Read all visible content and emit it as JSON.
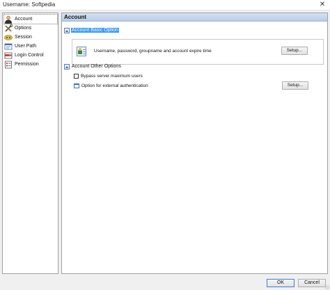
{
  "window": {
    "title": "Username: Softpedia",
    "close_glyph": "✕"
  },
  "sidebar": {
    "items": [
      {
        "label": "Account",
        "icon": "account-user-icon",
        "selected": true
      },
      {
        "label": "Options",
        "icon": "tools-icon",
        "selected": false
      },
      {
        "label": "Session",
        "icon": "session-icon",
        "selected": false
      },
      {
        "label": "User Path",
        "icon": "user-path-icon",
        "selected": false
      },
      {
        "label": "Login Control",
        "icon": "login-control-icon",
        "selected": false
      },
      {
        "label": "Permission",
        "icon": "permission-icon",
        "selected": false
      }
    ]
  },
  "main": {
    "header": "Account",
    "basic_section": {
      "title": "Account Basic Option",
      "description": "Username, password, groupname and account expire time",
      "setup_label": "Setup..."
    },
    "other_section": {
      "title": "Account Other Options",
      "options": [
        {
          "label": "Bypass server maximum users",
          "type": "checkbox",
          "checked": false
        },
        {
          "label": "Option for external authentication",
          "type": "window",
          "setup_label": "Setup..."
        }
      ]
    }
  },
  "footer": {
    "ok_label": "OK",
    "cancel_label": "Cancel"
  },
  "colors": {
    "selection": "#3399ff",
    "header_gradient": "#c7d7ee",
    "accent_border": "#3c7fd6"
  }
}
